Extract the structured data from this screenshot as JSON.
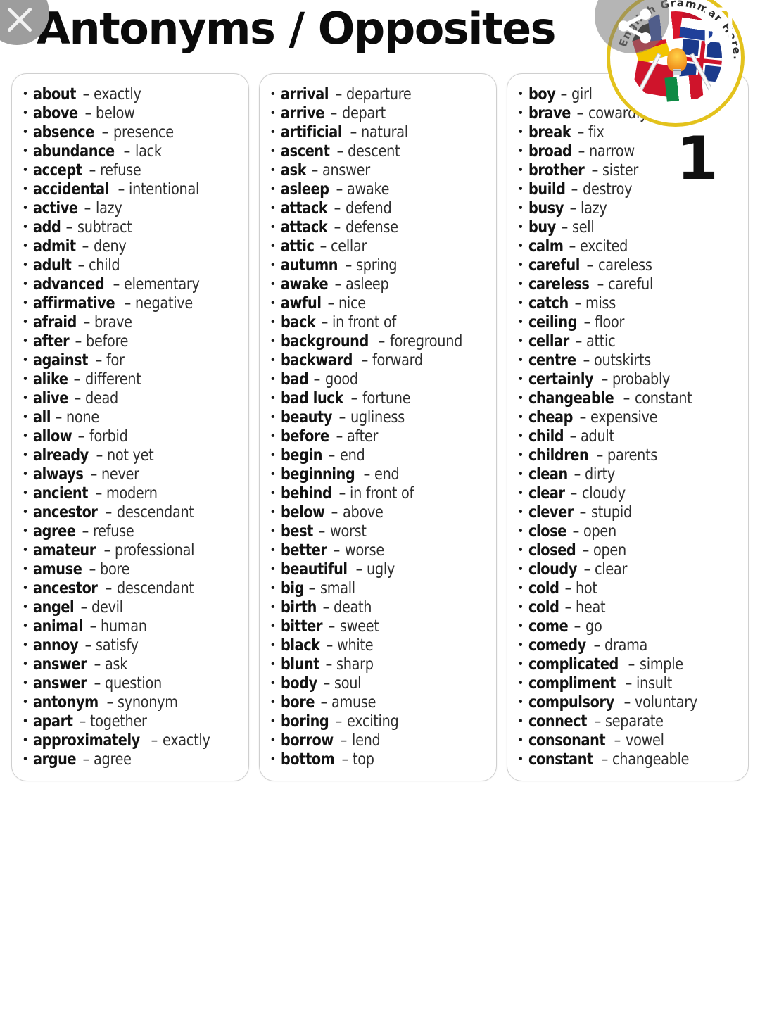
{
  "header": {
    "title": "Antonyms / Opposites",
    "close_icon": "close-icon",
    "share_icon": "share-icon",
    "bookmark_icon": "bookmark-icon",
    "logo_text": "English Grammar Here.Com"
  },
  "page_number": "1",
  "columns": [
    {
      "id": "column-1",
      "items": [
        {
          "word": "about",
          "dash": "–",
          "opposite": "exactly"
        },
        {
          "word": "above",
          "dash": "–",
          "opposite": "below"
        },
        {
          "word": "absence",
          "dash": "–",
          "opposite": "presence"
        },
        {
          "word": "abundance",
          "dash": "–",
          "opposite": "lack"
        },
        {
          "word": "accept",
          "dash": "–",
          "opposite": "refuse"
        },
        {
          "word": "accidental",
          "dash": "–",
          "opposite": "intentional"
        },
        {
          "word": "active",
          "dash": "–",
          "opposite": "lazy"
        },
        {
          "word": "add",
          "dash": "–",
          "opposite": "subtract"
        },
        {
          "word": "admit",
          "dash": "–",
          "opposite": "deny"
        },
        {
          "word": "adult",
          "dash": "–",
          "opposite": "child"
        },
        {
          "word": "advanced",
          "dash": "–",
          "opposite": "elementary"
        },
        {
          "word": "affirmative",
          "dash": "–",
          "opposite": "negative"
        },
        {
          "word": "afraid",
          "dash": "–",
          "opposite": "brave"
        },
        {
          "word": "after",
          "dash": "–",
          "opposite": "before"
        },
        {
          "word": "against",
          "dash": "–",
          "opposite": "for"
        },
        {
          "word": "alike",
          "dash": "–",
          "opposite": "different"
        },
        {
          "word": "alive",
          "dash": "–",
          "opposite": "dead"
        },
        {
          "word": "all",
          "dash": "–",
          "opposite": "none"
        },
        {
          "word": "allow",
          "dash": "–",
          "opposite": "forbid"
        },
        {
          "word": "already",
          "dash": "–",
          "opposite": "not yet"
        },
        {
          "word": "always",
          "dash": "–",
          "opposite": "never"
        },
        {
          "word": "ancient",
          "dash": "–",
          "opposite": "modern"
        },
        {
          "word": "ancestor",
          "dash": "–",
          "opposite": "descendant"
        },
        {
          "word": "agree",
          "dash": "–",
          "opposite": "refuse"
        },
        {
          "word": "amateur",
          "dash": "–",
          "opposite": "professional"
        },
        {
          "word": "amuse",
          "dash": "–",
          "opposite": "bore"
        },
        {
          "word": "ancestor",
          "dash": "–",
          "opposite": "descendant"
        },
        {
          "word": "angel",
          "dash": "–",
          "opposite": "devil"
        },
        {
          "word": "animal",
          "dash": "–",
          "opposite": "human"
        },
        {
          "word": "annoy",
          "dash": "–",
          "opposite": "satisfy"
        },
        {
          "word": "answer",
          "dash": "–",
          "opposite": "ask"
        },
        {
          "word": "answer",
          "dash": "–",
          "opposite": "question"
        },
        {
          "word": "antonym",
          "dash": "–",
          "opposite": "synonym"
        },
        {
          "word": "apart",
          "dash": "–",
          "opposite": "together"
        },
        {
          "word": "approximately",
          "dash": "–",
          "opposite": "exactly"
        },
        {
          "word": "argue",
          "dash": "–",
          "opposite": "agree"
        }
      ]
    },
    {
      "id": "column-2",
      "items": [
        {
          "word": "arrival",
          "dash": "–",
          "opposite": "departure"
        },
        {
          "word": "arrive",
          "dash": "–",
          "opposite": "depart"
        },
        {
          "word": "artificial",
          "dash": "–",
          "opposite": "natural"
        },
        {
          "word": "ascent",
          "dash": "–",
          "opposite": "descent"
        },
        {
          "word": "ask",
          "dash": "–",
          "opposite": "answer"
        },
        {
          "word": "asleep",
          "dash": "–",
          "opposite": "awake"
        },
        {
          "word": "attack",
          "dash": "–",
          "opposite": "defend"
        },
        {
          "word": "attack",
          "dash": "–",
          "opposite": "defense"
        },
        {
          "word": "attic",
          "dash": "–",
          "opposite": "cellar"
        },
        {
          "word": "autumn",
          "dash": "–",
          "opposite": "spring"
        },
        {
          "word": "awake",
          "dash": "–",
          "opposite": "asleep"
        },
        {
          "word": "awful",
          "dash": "–",
          "opposite": "nice"
        },
        {
          "word": "back",
          "dash": "–",
          "opposite": "in front of"
        },
        {
          "word": "background",
          "dash": "–",
          "opposite": "foreground"
        },
        {
          "word": "backward",
          "dash": "–",
          "opposite": "forward"
        },
        {
          "word": "bad",
          "dash": "–",
          "opposite": "good"
        },
        {
          "word": "bad luck",
          "dash": "–",
          "opposite": "fortune"
        },
        {
          "word": "beauty",
          "dash": "–",
          "opposite": "ugliness"
        },
        {
          "word": "before",
          "dash": "–",
          "opposite": "after"
        },
        {
          "word": "begin",
          "dash": "–",
          "opposite": "end"
        },
        {
          "word": "beginning",
          "dash": "–",
          "opposite": "end"
        },
        {
          "word": "behind",
          "dash": "–",
          "opposite": "in front of"
        },
        {
          "word": "below",
          "dash": "–",
          "opposite": "above"
        },
        {
          "word": "best",
          "dash": "–",
          "opposite": "worst"
        },
        {
          "word": "better",
          "dash": "–",
          "opposite": "worse"
        },
        {
          "word": "beautiful",
          "dash": "–",
          "opposite": "ugly"
        },
        {
          "word": "big",
          "dash": "–",
          "opposite": "small"
        },
        {
          "word": "birth",
          "dash": "–",
          "opposite": "death"
        },
        {
          "word": "bitter",
          "dash": "–",
          "opposite": "sweet"
        },
        {
          "word": "black",
          "dash": "–",
          "opposite": "white"
        },
        {
          "word": "blunt",
          "dash": "–",
          "opposite": "sharp"
        },
        {
          "word": "body",
          "dash": "–",
          "opposite": "soul"
        },
        {
          "word": "bore",
          "dash": "–",
          "opposite": "amuse"
        },
        {
          "word": "boring",
          "dash": "–",
          "opposite": "exciting"
        },
        {
          "word": "borrow",
          "dash": "–",
          "opposite": "lend"
        },
        {
          "word": "bottom",
          "dash": "–",
          "opposite": "top"
        }
      ]
    },
    {
      "id": "column-3",
      "items": [
        {
          "word": "boy",
          "dash": "–",
          "opposite": "girl"
        },
        {
          "word": "brave",
          "dash": "–",
          "opposite": "cowardly"
        },
        {
          "word": "break",
          "dash": "–",
          "opposite": "fix"
        },
        {
          "word": "broad",
          "dash": "–",
          "opposite": "narrow"
        },
        {
          "word": "brother",
          "dash": "–",
          "opposite": "sister"
        },
        {
          "word": "build",
          "dash": "–",
          "opposite": "destroy"
        },
        {
          "word": "busy",
          "dash": "–",
          "opposite": "lazy"
        },
        {
          "word": "buy",
          "dash": "–",
          "opposite": "sell"
        },
        {
          "word": "calm",
          "dash": "–",
          "opposite": "excited"
        },
        {
          "word": "careful",
          "dash": "–",
          "opposite": "careless"
        },
        {
          "word": "careless",
          "dash": "–",
          "opposite": "careful"
        },
        {
          "word": "catch",
          "dash": "–",
          "opposite": "miss"
        },
        {
          "word": "ceiling",
          "dash": "–",
          "opposite": "floor"
        },
        {
          "word": "cellar",
          "dash": "–",
          "opposite": "attic"
        },
        {
          "word": "centre",
          "dash": "–",
          "opposite": "outskirts"
        },
        {
          "word": "certainly",
          "dash": "–",
          "opposite": "probably"
        },
        {
          "word": "changeable",
          "dash": "–",
          "opposite": "constant"
        },
        {
          "word": "cheap",
          "dash": "–",
          "opposite": "expensive"
        },
        {
          "word": "child",
          "dash": "–",
          "opposite": "adult"
        },
        {
          "word": "children",
          "dash": "–",
          "opposite": "parents"
        },
        {
          "word": "clean",
          "dash": "–",
          "opposite": "dirty"
        },
        {
          "word": "clear",
          "dash": "–",
          "opposite": "cloudy"
        },
        {
          "word": "clever",
          "dash": "–",
          "opposite": "stupid"
        },
        {
          "word": "close",
          "dash": "–",
          "opposite": "open"
        },
        {
          "word": "closed",
          "dash": "–",
          "opposite": "open"
        },
        {
          "word": "cloudy",
          "dash": "–",
          "opposite": "clear"
        },
        {
          "word": "cold",
          "dash": "–",
          "opposite": "hot"
        },
        {
          "word": "cold",
          "dash": "–",
          "opposite": "heat"
        },
        {
          "word": "come",
          "dash": "–",
          "opposite": "go"
        },
        {
          "word": "comedy",
          "dash": "–",
          "opposite": "drama"
        },
        {
          "word": "complicated",
          "dash": "–",
          "opposite": "simple"
        },
        {
          "word": "compliment",
          "dash": "–",
          "opposite": "insult"
        },
        {
          "word": "compulsory",
          "dash": "–",
          "opposite": "voluntary"
        },
        {
          "word": "connect",
          "dash": "–",
          "opposite": "separate"
        },
        {
          "word": "consonant",
          "dash": "–",
          "opposite": "vowel"
        },
        {
          "word": "constant",
          "dash": "–",
          "opposite": "changeable"
        }
      ]
    }
  ],
  "colors": {
    "background": "#ffffff",
    "text": "#131313",
    "card_border": "#cfcfcf",
    "logo_ring": "#e3c21c",
    "close_button": "#9d9d9d"
  }
}
